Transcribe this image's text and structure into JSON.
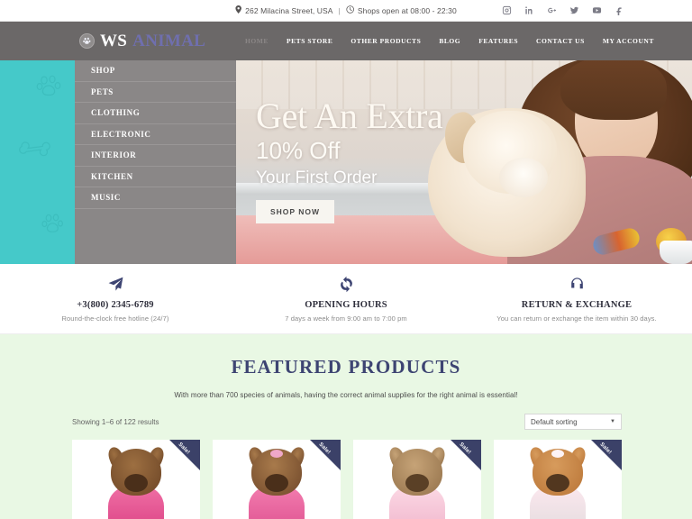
{
  "topbar": {
    "address": "262 Milacina Street, USA",
    "separator": "|",
    "hours": "Shops open at 08:00 - 22:30",
    "location_icon": "map-pin-icon",
    "clock_icon": "clock-icon",
    "social": [
      {
        "name": "instagram-icon",
        "label": "Instagram"
      },
      {
        "name": "linkedin-icon",
        "label": "LinkedIn"
      },
      {
        "name": "googleplus-icon",
        "label": "Google Plus"
      },
      {
        "name": "twitter-icon",
        "label": "Twitter"
      },
      {
        "name": "youtube-icon",
        "label": "YouTube"
      },
      {
        "name": "facebook-icon",
        "label": "Facebook"
      }
    ]
  },
  "header": {
    "logo_primary": "WS",
    "logo_secondary": "ANIMAL",
    "logo_icon": "paw-circle-icon",
    "nav": [
      {
        "label": "HOME",
        "active": true
      },
      {
        "label": "PETS STORE",
        "active": false
      },
      {
        "label": "OTHER PRODUCTS",
        "active": false
      },
      {
        "label": "BLOG",
        "active": false
      },
      {
        "label": "FEATURES",
        "active": false
      },
      {
        "label": "CONTACT US",
        "active": false
      },
      {
        "label": "MY ACCOUNT",
        "active": false
      }
    ],
    "background_color": "#6b6868",
    "accent_color": "#6f6fae"
  },
  "categories": {
    "background_color": "#8a8787",
    "items": [
      {
        "label": "SHOP"
      },
      {
        "label": "PETS"
      },
      {
        "label": "CLOTHING"
      },
      {
        "label": "ELECTRONIC"
      },
      {
        "label": "INTERIOR"
      },
      {
        "label": "KITCHEN"
      },
      {
        "label": "MUSIC"
      }
    ]
  },
  "hero": {
    "line1": "Get An Extra",
    "line2": "10% Off",
    "line3": "Your First Order",
    "button": "SHOP NOW",
    "teal_color": "#45c9c9"
  },
  "services": [
    {
      "icon": "paper-plane-icon",
      "title": "+3(800) 2345-6789",
      "subtitle": "Round-the-clock free hotline (24/7)"
    },
    {
      "icon": "refresh-icon",
      "title": "OPENING HOURS",
      "subtitle": "7 days a week from 9:00 am to 7:00 pm"
    },
    {
      "icon": "headphones-icon",
      "title": "RETURN & EXCHANGE",
      "subtitle": "You can return or exchange the item within 30 days."
    }
  ],
  "featured": {
    "title": "FEATURED PRODUCTS",
    "subtitle": "With more than 700 species of animals, having the correct animal supplies for the right animal is essential!",
    "result_count": "Showing 1–6 of 122 results",
    "sort_value": "Default sorting",
    "sort_caret": "▼",
    "background_color": "#e9f8e4",
    "title_color": "#3d4472",
    "sale_badge": "Sale!",
    "sale_color": "#3b4168",
    "products": [
      {
        "badge": "Sale!",
        "alt": "yorkshire terrier in pink sweater"
      },
      {
        "badge": "Sale!",
        "alt": "yorkshire terrier with pink bow in pink shirt"
      },
      {
        "badge": "Sale!",
        "alt": "yorkshire terrier in pale pink hoodie"
      },
      {
        "badge": "Sale!",
        "alt": "poodle puppy with white bow in white dress"
      }
    ]
  }
}
